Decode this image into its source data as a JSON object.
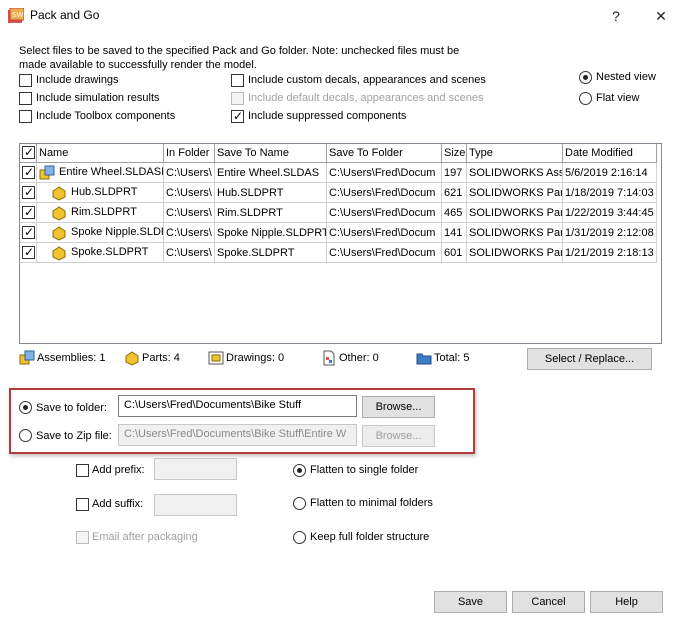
{
  "window": {
    "title": "Pack and Go",
    "help_glyph": "?",
    "close_glyph": "✕"
  },
  "intro_text": "Select files to be saved to the specified Pack and Go folder.  Note: unchecked files must be made available to successfully render the model.",
  "options": {
    "include_drawings": "Include drawings",
    "include_simulation": "Include simulation results",
    "include_toolbox": "Include Toolbox components",
    "include_custom_decals": "Include custom decals, appearances and scenes",
    "include_default_decals": "Include default decals, appearances and scenes",
    "include_suppressed": "Include suppressed components"
  },
  "view": {
    "nested": "Nested view",
    "flat": "Flat view",
    "selected": "nested"
  },
  "table": {
    "columns": [
      "Name",
      "In Folder",
      "Save To Name",
      "Save To Folder",
      "Size",
      "Type",
      "Date Modified"
    ],
    "rows": [
      {
        "checked": true,
        "icon": "assembly-icon",
        "name": "Entire Wheel.SLDASM",
        "in_folder": "C:\\Users\\",
        "save_name": "Entire Wheel.SLDAS",
        "save_folder": "C:\\Users\\Fred\\Docum",
        "size": "197",
        "type": "SOLIDWORKS Ass",
        "date": "5/6/2019 2:16:14"
      },
      {
        "checked": true,
        "icon": "part-icon",
        "name": "Hub.SLDPRT",
        "in_folder": "C:\\Users\\",
        "save_name": "Hub.SLDPRT",
        "save_folder": "C:\\Users\\Fred\\Docum",
        "size": "621",
        "type": "SOLIDWORKS Part",
        "date": "1/18/2019 7:14:03"
      },
      {
        "checked": true,
        "icon": "part-icon",
        "name": "Rim.SLDPRT",
        "in_folder": "C:\\Users\\",
        "save_name": "Rim.SLDPRT",
        "save_folder": "C:\\Users\\Fred\\Docum",
        "size": "465",
        "type": "SOLIDWORKS Part",
        "date": "1/22/2019 3:44:45"
      },
      {
        "checked": true,
        "icon": "part-icon",
        "name": "Spoke Nipple.SLDPRT",
        "in_folder": "C:\\Users\\",
        "save_name": "Spoke Nipple.SLDPRT",
        "save_folder": "C:\\Users\\Fred\\Docum",
        "size": "141",
        "type": "SOLIDWORKS Part",
        "date": "1/31/2019 2:12:08"
      },
      {
        "checked": true,
        "icon": "part-icon",
        "name": "Spoke.SLDPRT",
        "in_folder": "C:\\Users\\",
        "save_name": "Spoke.SLDPRT",
        "save_folder": "C:\\Users\\Fred\\Docum",
        "size": "601",
        "type": "SOLIDWORKS Part",
        "date": "1/21/2019 2:18:13"
      }
    ]
  },
  "summary": {
    "assemblies": "Assemblies: 1",
    "parts": "Parts: 4",
    "drawings": "Drawings: 0",
    "other": "Other: 0",
    "total": "Total: 5",
    "select_replace": "Select / Replace..."
  },
  "save": {
    "to_folder_label": "Save to folder:",
    "to_folder_value": "C:\\Users\\Fred\\Documents\\Bike Stuff",
    "to_zip_label": "Save to Zip file:",
    "to_zip_value": "C:\\Users\\Fred\\Documents\\Bike Stuff\\Entire W",
    "browse": "Browse...",
    "selected": "folder"
  },
  "naming": {
    "add_prefix": "Add prefix:",
    "add_suffix": "Add suffix:",
    "email_after": "Email after packaging"
  },
  "structure": {
    "flatten_single": "Flatten to single folder",
    "flatten_minimal": "Flatten to minimal folders",
    "keep_full": "Keep full folder structure",
    "selected": "single"
  },
  "buttons": {
    "save": "Save",
    "cancel": "Cancel",
    "help": "Help"
  },
  "colors": {
    "highlight_border": "#b33a3a",
    "part_yellow": "#f2c230",
    "folder_blue": "#3b7dc4"
  }
}
